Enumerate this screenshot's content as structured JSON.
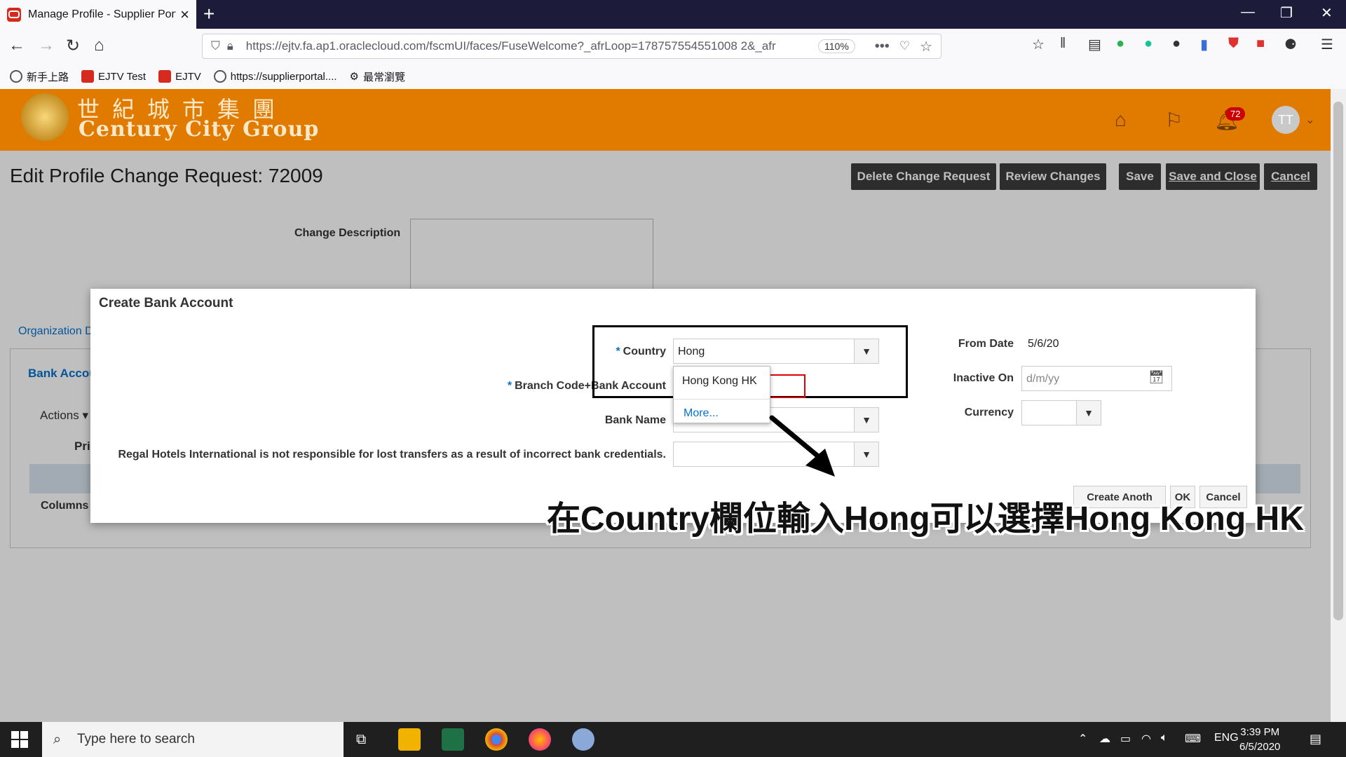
{
  "browser": {
    "tab_title": "Manage Profile - Supplier Portal",
    "url": "https://ejtv.fa.ap1.oraclecloud.com/fscmUI/faces/FuseWelcome?_afrLoop=178757554551008 2&_afr",
    "zoom": "110%",
    "bookmarks": [
      "新手上路",
      "EJTV Test",
      "EJTV",
      "https://supplierportal....",
      "最常瀏覽"
    ]
  },
  "header": {
    "logo_cn": "世紀城市集團",
    "logo_en": "Century City Group",
    "notification_count": "72",
    "avatar_initials": "TT"
  },
  "page": {
    "title": "Edit Profile Change Request: 72009",
    "buttons": [
      "Delete Change Request",
      "Review Changes",
      "Save",
      "Save and Close",
      "Cancel"
    ],
    "change_description_label": "Change Description",
    "org_link": "Organization D",
    "bank_tab": "Bank Accou",
    "actions_label": "Actions",
    "columns_label": "Columns",
    "pri_label": "Pri"
  },
  "dialog": {
    "title": "Create Bank Account",
    "country_label": "Country",
    "country_value": "Hong",
    "branch_label": "Branch Code+Bank Account",
    "bank_name_label": "Bank Name",
    "disclaimer_label": "Regal Hotels International is not responsible for lost transfers as a result of incorrect bank credentials.",
    "from_date_label": "From Date",
    "from_date_value": "5/6/20",
    "inactive_on_label": "Inactive On",
    "inactive_on_placeholder": "d/m/yy",
    "currency_label": "Currency",
    "dropdown_option": "Hong Kong HK",
    "dropdown_more": "More...",
    "btn_create_another": "Create Anoth",
    "btn_ok": "OK",
    "btn_cancel": "Cancel"
  },
  "annotation": {
    "caption": "在Country欄位輸入Hong可以選擇Hong Kong HK"
  },
  "taskbar": {
    "search_placeholder": "Type here to search",
    "lang": "ENG",
    "time": "3:39 PM",
    "date": "6/5/2020"
  }
}
